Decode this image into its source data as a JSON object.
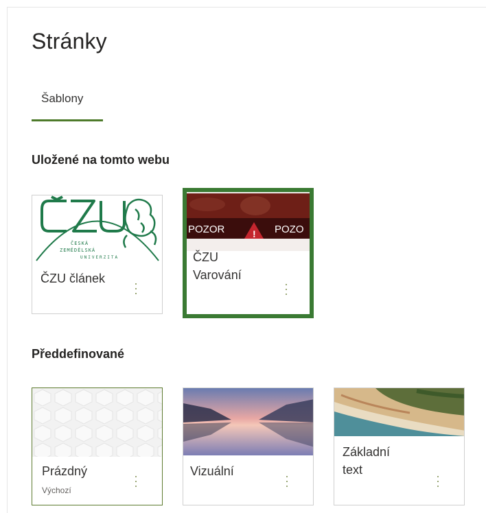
{
  "page": {
    "title": "Stránky"
  },
  "tabs": [
    {
      "label": "Šablony",
      "selected": true
    }
  ],
  "sections": {
    "saved": {
      "heading": "Uložené na tomto webu",
      "cards": [
        {
          "name": "ČZU článek",
          "logo_text": "ČESKÁ ZEMĚDĚLSKÁ UNIVERZITA",
          "logo_letters": "ČZU"
        },
        {
          "name_line1": "ČZU",
          "name_line2": "Varování",
          "banner_left": "POZOR",
          "banner_right": "POZO",
          "selected": true
        }
      ]
    },
    "predefined": {
      "heading": "Předdefinované",
      "cards": [
        {
          "name": "Prázdný",
          "subtitle": "Výchozí"
        },
        {
          "name": "Vizuální"
        },
        {
          "name_line1": "Základní",
          "name_line2": "text"
        }
      ]
    }
  },
  "colors": {
    "accent": "#4d7a2a",
    "selection": "#3a7a33",
    "czu_green": "#1f7a4a",
    "banner_dark": "#3b0d0c",
    "banner_red": "#c4262e"
  },
  "icons": {
    "more": "vertical-ellipsis-icon",
    "warning": "warning-triangle-icon"
  }
}
